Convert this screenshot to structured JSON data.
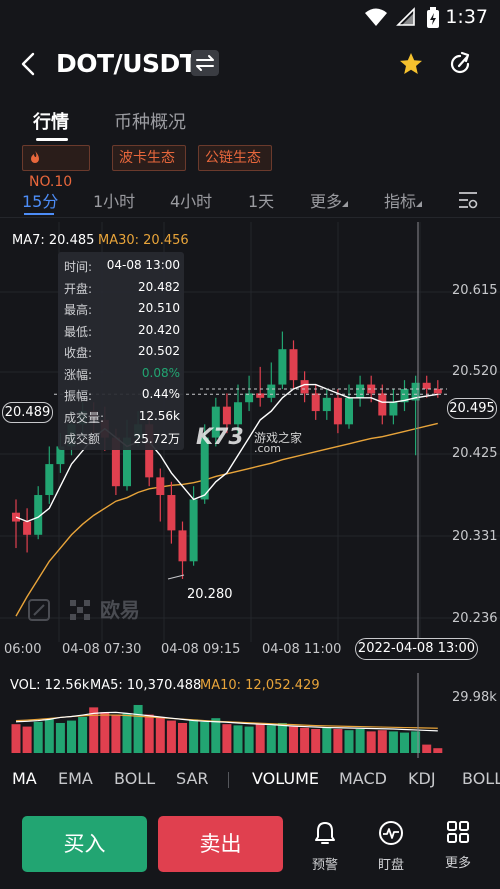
{
  "status_bar": {
    "time": "1:37"
  },
  "header": {
    "pair": "DOT/USDT"
  },
  "tabs": [
    {
      "label": "行情"
    },
    {
      "label": "币种概况"
    }
  ],
  "tags": [
    {
      "label": "NO.10"
    },
    {
      "label": "波卡生态"
    },
    {
      "label": "公链生态"
    }
  ],
  "intervals": [
    {
      "label": "15分"
    },
    {
      "label": "1小时"
    },
    {
      "label": "4小时"
    },
    {
      "label": "1天"
    },
    {
      "label": "更多"
    },
    {
      "label": "指标"
    }
  ],
  "ma_legend": {
    "ma7": "MA7: 20.485",
    "ma30": "MA30: 20.456"
  },
  "price_axis": [
    "20.615",
    "20.520",
    "20.425",
    "20.331",
    "20.236"
  ],
  "current_price": "20.495",
  "crosshair_price": "20.489",
  "low_label": "20.280",
  "time_axis": [
    "06:00",
    "04-08 07:30",
    "04-08 09:15",
    "04-08 11:00",
    "2022-04-08 13:00"
  ],
  "tooltip": {
    "rows": [
      {
        "k": "时间:",
        "v": "04-08 13:00"
      },
      {
        "k": "开盘:",
        "v": "20.482"
      },
      {
        "k": "最高:",
        "v": "20.510"
      },
      {
        "k": "最低:",
        "v": "20.420"
      },
      {
        "k": "收盘:",
        "v": "20.502"
      },
      {
        "k": "涨幅:",
        "v": "0.08%"
      },
      {
        "k": "振幅:",
        "v": "0.44%"
      },
      {
        "k": "成交量:",
        "v": "12.56k"
      },
      {
        "k": "成交额",
        "v": "25.72万"
      }
    ]
  },
  "watermark": {
    "brand": "欧易",
    "site": "游戏之家",
    "url": ".com"
  },
  "volume_legend": {
    "vol": "VOL: 12.56k",
    "ma5": "MA5: 10,370.488",
    "ma10": "MA10: 12,052.429"
  },
  "volume_axis_max": "29.98k",
  "indicators": [
    "MA",
    "EMA",
    "BOLL",
    "SAR",
    "VOLUME",
    "MACD",
    "KDJ",
    "BOLL"
  ],
  "actions": {
    "buy": "买入",
    "sell": "卖出",
    "alert": "预警",
    "watch": "盯盘",
    "more": "更多"
  },
  "colors": {
    "up": "#22a572",
    "down": "#e0404f",
    "ma7": "#ffffff",
    "ma30": "#e8a43a",
    "accent": "#4d8df7"
  },
  "chart_data": {
    "type": "candlestick",
    "price_range": [
      20.22,
      20.65
    ],
    "candles": [
      {
        "o": 20.355,
        "c": 20.345,
        "h": 20.37,
        "l": 20.315
      },
      {
        "o": 20.345,
        "c": 20.33,
        "h": 20.36,
        "l": 20.31
      },
      {
        "o": 20.33,
        "c": 20.375,
        "h": 20.385,
        "l": 20.325
      },
      {
        "o": 20.375,
        "c": 20.41,
        "h": 20.43,
        "l": 20.365
      },
      {
        "o": 20.41,
        "c": 20.43,
        "h": 20.445,
        "l": 20.4
      },
      {
        "o": 20.43,
        "c": 20.455,
        "h": 20.47,
        "l": 20.42
      },
      {
        "o": 20.455,
        "c": 20.47,
        "h": 20.48,
        "l": 20.44
      },
      {
        "o": 20.47,
        "c": 20.46,
        "h": 20.48,
        "l": 20.445
      },
      {
        "o": 20.46,
        "c": 20.44,
        "h": 20.475,
        "l": 20.425
      },
      {
        "o": 20.44,
        "c": 20.385,
        "h": 20.45,
        "l": 20.375
      },
      {
        "o": 20.385,
        "c": 20.44,
        "h": 20.46,
        "l": 20.38
      },
      {
        "o": 20.44,
        "c": 20.455,
        "h": 20.47,
        "l": 20.43
      },
      {
        "o": 20.455,
        "c": 20.395,
        "h": 20.47,
        "l": 20.385
      },
      {
        "o": 20.395,
        "c": 20.375,
        "h": 20.405,
        "l": 20.345
      },
      {
        "o": 20.375,
        "c": 20.335,
        "h": 20.39,
        "l": 20.32
      },
      {
        "o": 20.335,
        "c": 20.3,
        "h": 20.345,
        "l": 20.28
      },
      {
        "o": 20.3,
        "c": 20.37,
        "h": 20.385,
        "l": 20.295
      },
      {
        "o": 20.37,
        "c": 20.44,
        "h": 20.455,
        "l": 20.365
      },
      {
        "o": 20.44,
        "c": 20.475,
        "h": 20.485,
        "l": 20.43
      },
      {
        "o": 20.475,
        "c": 20.455,
        "h": 20.49,
        "l": 20.445
      },
      {
        "o": 20.455,
        "c": 20.48,
        "h": 20.5,
        "l": 20.445
      },
      {
        "o": 20.48,
        "c": 20.49,
        "h": 20.51,
        "l": 20.47
      },
      {
        "o": 20.49,
        "c": 20.485,
        "h": 20.52,
        "l": 20.475
      },
      {
        "o": 20.485,
        "c": 20.5,
        "h": 20.525,
        "l": 20.48
      },
      {
        "o": 20.5,
        "c": 20.54,
        "h": 20.56,
        "l": 20.495
      },
      {
        "o": 20.54,
        "c": 20.505,
        "h": 20.55,
        "l": 20.495
      },
      {
        "o": 20.505,
        "c": 20.49,
        "h": 20.515,
        "l": 20.48
      },
      {
        "o": 20.49,
        "c": 20.47,
        "h": 20.5,
        "l": 20.46
      },
      {
        "o": 20.47,
        "c": 20.485,
        "h": 20.495,
        "l": 20.46
      },
      {
        "o": 20.485,
        "c": 20.455,
        "h": 20.495,
        "l": 20.445
      },
      {
        "o": 20.455,
        "c": 20.485,
        "h": 20.5,
        "l": 20.45
      },
      {
        "o": 20.485,
        "c": 20.5,
        "h": 20.51,
        "l": 20.475
      },
      {
        "o": 20.5,
        "c": 20.49,
        "h": 20.51,
        "l": 20.48
      },
      {
        "o": 20.49,
        "c": 20.465,
        "h": 20.5,
        "l": 20.455
      },
      {
        "o": 20.465,
        "c": 20.48,
        "h": 20.495,
        "l": 20.455
      },
      {
        "o": 20.48,
        "c": 20.495,
        "h": 20.505,
        "l": 20.47
      },
      {
        "o": 20.482,
        "c": 20.502,
        "h": 20.51,
        "l": 20.42
      },
      {
        "o": 20.502,
        "c": 20.495,
        "h": 20.51,
        "l": 20.485
      },
      {
        "o": 20.495,
        "c": 20.49,
        "h": 20.505,
        "l": 20.485
      }
    ],
    "ma7": [
      20.35,
      20.345,
      20.35,
      20.36,
      20.385,
      20.41,
      20.425,
      20.44,
      20.45,
      20.44,
      20.43,
      20.435,
      20.435,
      20.42,
      20.4,
      20.385,
      20.37,
      20.375,
      20.39,
      20.4,
      20.42,
      20.44,
      20.46,
      20.47,
      20.485,
      20.495,
      20.5,
      20.5,
      20.495,
      20.49,
      20.485,
      20.485,
      20.485,
      20.48,
      20.48,
      20.482,
      20.485,
      20.487,
      20.489
    ],
    "ma30": [
      20.238,
      20.26,
      20.28,
      20.3,
      20.315,
      20.33,
      20.342,
      20.352,
      20.36,
      20.368,
      20.372,
      20.378,
      20.382,
      20.384,
      20.386,
      20.387,
      20.389,
      20.392,
      20.396,
      20.399,
      20.402,
      20.405,
      20.408,
      20.411,
      20.415,
      20.418,
      20.421,
      20.424,
      20.427,
      20.43,
      20.433,
      20.436,
      20.439,
      20.441,
      20.444,
      20.447,
      20.45,
      20.453,
      20.456
    ],
    "volume": {
      "max": 29980,
      "values": [
        12000,
        11000,
        13000,
        14000,
        12500,
        13500,
        15000,
        19000,
        17000,
        16000,
        16500,
        20000,
        16000,
        15000,
        13500,
        12500,
        14000,
        13000,
        14500,
        12000,
        11500,
        11000,
        12000,
        11500,
        12500,
        11000,
        10500,
        10000,
        10500,
        10000,
        9500,
        10000,
        9000,
        9500,
        9000,
        8500,
        9000,
        3500,
        2000
      ],
      "ma5": [
        13000,
        13200,
        13500,
        14000,
        14800,
        15200,
        15800,
        16500,
        16800,
        16900,
        16500,
        16000,
        15500,
        15000,
        14500,
        14000,
        13500,
        13200,
        13000,
        12800,
        12500,
        12200,
        12000,
        11800,
        11500,
        11200,
        11000,
        10800,
        10600,
        10500,
        10400,
        10300,
        10200,
        10100,
        10000,
        9800,
        9600,
        9400,
        9200
      ],
      "ma10": [
        13500,
        13700,
        14000,
        14400,
        14800,
        15200,
        15500,
        15700,
        15800,
        15800,
        15600,
        15300,
        15000,
        14700,
        14400,
        14100,
        13800,
        13500,
        13200,
        13000,
        12800,
        12600,
        12400,
        12200,
        12000,
        11800,
        11600,
        11400,
        11300,
        11200,
        11100,
        11000,
        10900,
        10800,
        10700,
        10600,
        10500,
        10400,
        10300
      ]
    }
  }
}
